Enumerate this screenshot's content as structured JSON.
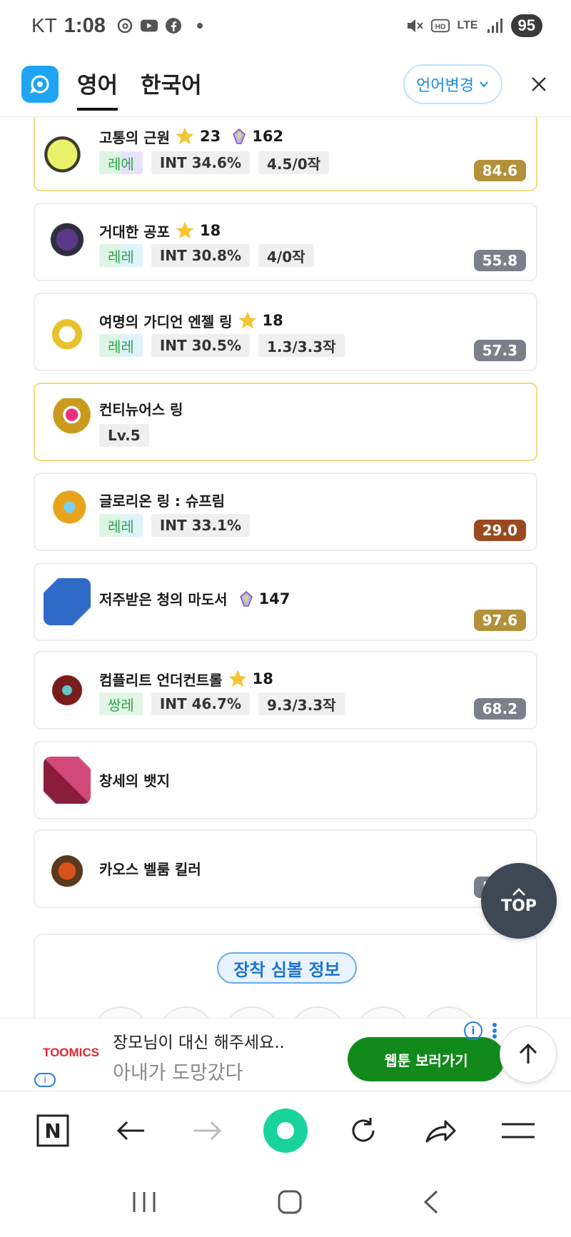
{
  "status_bar": {
    "carrier": "KT",
    "time": "1:08",
    "network": "LTE",
    "battery": "95"
  },
  "translate_bar": {
    "tab_source": "영어",
    "tab_target": "한국어",
    "change_language": "언어변경"
  },
  "items": [
    {
      "name": "고통의 근원",
      "stars": "23",
      "gem": "162",
      "grade": "레에",
      "stat": "INT 34.6%",
      "upgrade": "4.5/0작",
      "score": "84.6",
      "score_color": "#b3913a"
    },
    {
      "name": "거대한 공포",
      "stars": "18",
      "grade": "레레",
      "stat": "INT 30.8%",
      "upgrade": "4/0작",
      "score": "55.8",
      "score_color": "#7b7f8a"
    },
    {
      "name": "여명의 가디언 엔젤 링",
      "stars": "18",
      "grade": "레레",
      "stat": "INT 30.5%",
      "upgrade": "1.3/3.3작",
      "score": "57.3",
      "score_color": "#7b7f8a"
    },
    {
      "name": "컨티뉴어스 링",
      "level": "Lv.5"
    },
    {
      "name": "글로리온 링 : 슈프림",
      "grade": "레레",
      "stat": "INT 33.1%",
      "score": "29.0",
      "score_color": "#9a4a1f"
    },
    {
      "name": "저주받은 청의 마도서",
      "gem": "147",
      "score": "97.6",
      "score_color": "#b3913a"
    },
    {
      "name": "컴플리트 언더컨트롤",
      "stars": "18",
      "grade": "쌍레",
      "stat": "INT 46.7%",
      "upgrade": "9.3/3.3작",
      "score": "68.2",
      "score_color": "#7b7f8a"
    },
    {
      "name": "창세의 뱃지"
    },
    {
      "name": "카오스 벨룸 킬러",
      "score": "57.6",
      "score_color": "#7b7f8a"
    }
  ],
  "symbol_section": {
    "button": "장착 심볼 정보"
  },
  "top_button": "TOP",
  "ad": {
    "brand": "TOOMICS",
    "line1": "장모님이 대신 해주세요..",
    "line2": "아내가 도망갔다",
    "cta": "웹툰 보러가기"
  },
  "browser_bar": {
    "n_icon": "N"
  }
}
